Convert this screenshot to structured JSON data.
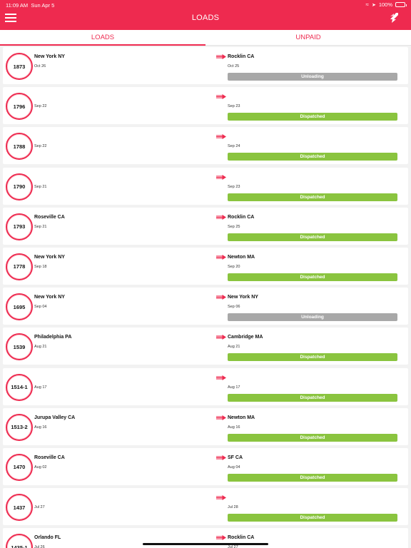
{
  "status_bar": {
    "time": "11:09 AM",
    "date": "Sun Apr 5",
    "battery": "100%"
  },
  "header": {
    "title": "LOADS"
  },
  "tabs": [
    {
      "label": "LOADS",
      "active": true
    },
    {
      "label": "UNPAID",
      "active": false
    }
  ],
  "colors": {
    "brand": "#ee2a4f",
    "dispatched": "#8ac43f",
    "unloading": "#a8a8a8"
  },
  "loads": [
    {
      "id": "1873",
      "origin": "New York NY",
      "origin_date": "Oct 26",
      "dest": "Rocklin CA",
      "dest_date": "Oct 25",
      "status": "Unloading"
    },
    {
      "id": "1796",
      "origin": "",
      "origin_date": "Sep 22",
      "dest": "",
      "dest_date": "Sep 23",
      "status": "Dispatched"
    },
    {
      "id": "1788",
      "origin": "",
      "origin_date": "Sep 22",
      "dest": "",
      "dest_date": "Sep 24",
      "status": "Dispatched"
    },
    {
      "id": "1790",
      "origin": "",
      "origin_date": "Sep 21",
      "dest": "",
      "dest_date": "Sep 23",
      "status": "Dispatched"
    },
    {
      "id": "1793",
      "origin": "Roseville CA",
      "origin_date": "Sep 21",
      "dest": "Rocklin CA",
      "dest_date": "Sep 25",
      "status": "Dispatched"
    },
    {
      "id": "1778",
      "origin": "New York NY",
      "origin_date": "Sep 18",
      "dest": "Newton MA",
      "dest_date": "Sep 20",
      "status": "Dispatched"
    },
    {
      "id": "1695",
      "origin": "New York NY",
      "origin_date": "Sep 04",
      "dest": "New York NY",
      "dest_date": "Sep 06",
      "status": "Unloading"
    },
    {
      "id": "1539",
      "origin": "Philadelphia PA",
      "origin_date": "Aug 21",
      "dest": "Cambridge MA",
      "dest_date": "Aug 21",
      "status": "Dispatched"
    },
    {
      "id": "1514-1",
      "origin": "",
      "origin_date": "Aug 17",
      "dest": "",
      "dest_date": "Aug 17",
      "status": "Dispatched"
    },
    {
      "id": "1513-2",
      "origin": "Jurupa Valley CA",
      "origin_date": "Aug 16",
      "dest": "Newton MA",
      "dest_date": "Aug 16",
      "status": "Dispatched"
    },
    {
      "id": "1470",
      "origin": "Roseville CA",
      "origin_date": "Aug 02",
      "dest": "SF CA",
      "dest_date": "Aug 04",
      "status": "Dispatched"
    },
    {
      "id": "1437",
      "origin": "",
      "origin_date": "Jul 27",
      "dest": "",
      "dest_date": "Jul 28",
      "status": "Dispatched"
    },
    {
      "id": "1435-1",
      "origin": "Orlando FL",
      "origin_date": "Jul 26",
      "dest": "Rocklin CA",
      "dest_date": "Jul 27",
      "status": ""
    }
  ]
}
